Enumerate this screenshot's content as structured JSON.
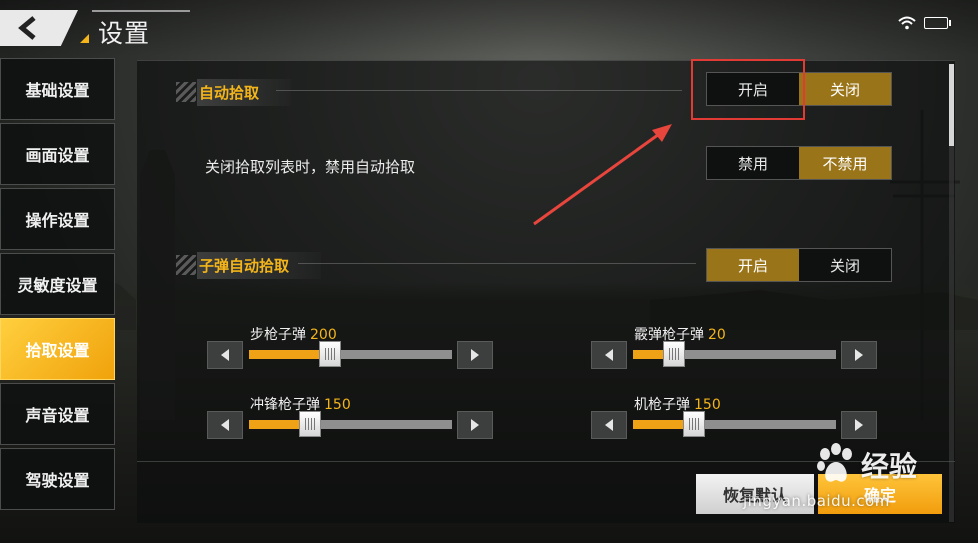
{
  "header": {
    "title": "设置"
  },
  "sidebar": {
    "items": [
      {
        "label": "基础设置"
      },
      {
        "label": "画面设置"
      },
      {
        "label": "操作设置"
      },
      {
        "label": "灵敏度设置"
      },
      {
        "label": "拾取设置",
        "active": true
      },
      {
        "label": "声音设置"
      },
      {
        "label": "驾驶设置"
      }
    ]
  },
  "settings": {
    "auto_pickup": {
      "title": "自动拾取",
      "on_label": "开启",
      "off_label": "关闭",
      "selected": "关闭"
    },
    "disable_when_list_closed": {
      "label": "关闭拾取列表时，禁用自动拾取",
      "disable_label": "禁用",
      "not_disable_label": "不禁用",
      "selected": "不禁用"
    },
    "ammo_auto_pickup": {
      "title": "子弹自动拾取",
      "on_label": "开启",
      "off_label": "关闭",
      "selected": "开启"
    },
    "ammo_sliders": [
      {
        "label": "步枪子弹",
        "value": "200",
        "fill_fraction": 0.4
      },
      {
        "label": "霰弹枪子弹",
        "value": "20",
        "fill_fraction": 0.2
      },
      {
        "label": "冲锋枪子弹",
        "value": "150",
        "fill_fraction": 0.3
      },
      {
        "label": "机枪子弹",
        "value": "150",
        "fill_fraction": 0.3
      }
    ]
  },
  "footer": {
    "reset_label": "恢复默认",
    "confirm_label": "确定"
  },
  "watermark": {
    "brand": "经验",
    "url": "jingyan.baidu.com"
  },
  "colors": {
    "accent": "#f3b51a",
    "selected_toggle": "#9a7418",
    "highlight_box": "#e23a35",
    "arrow": "#e8453c"
  }
}
